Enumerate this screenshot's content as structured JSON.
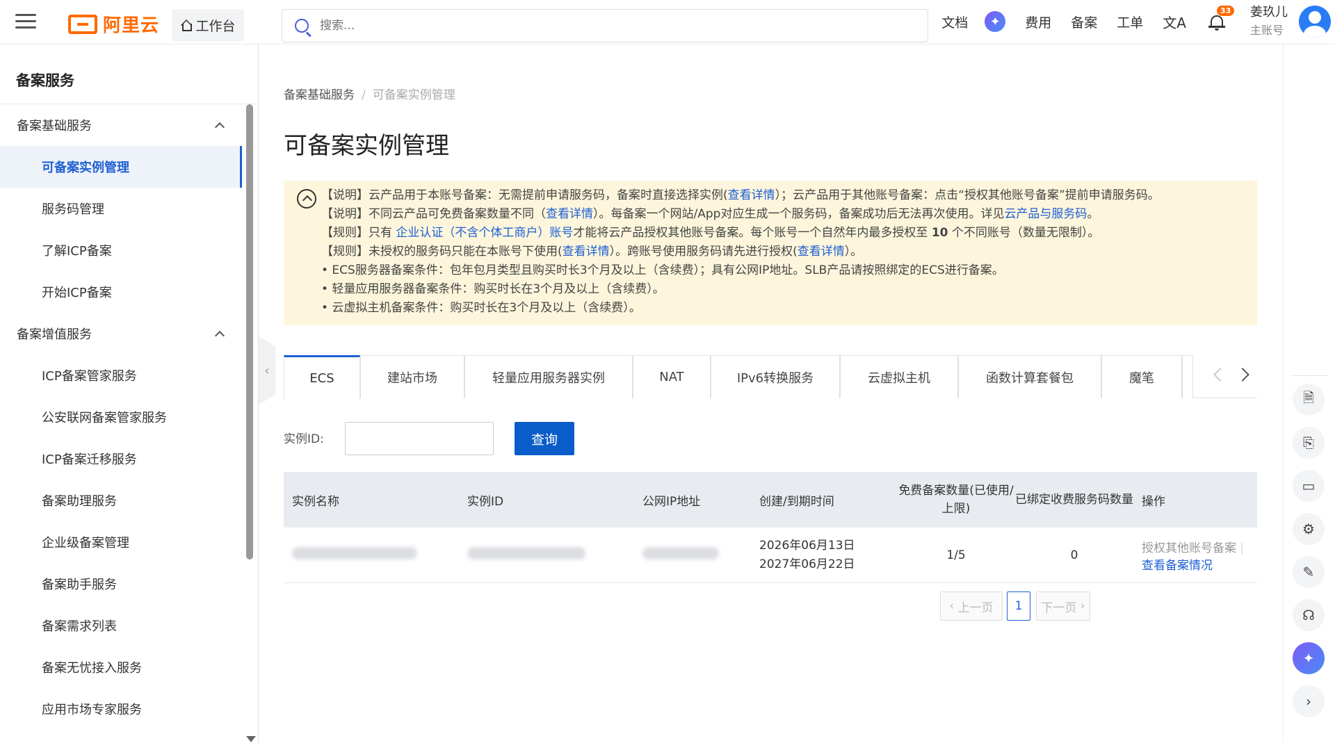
{
  "header": {
    "logo_text": "阿里云",
    "workbench": "工作台",
    "search_placeholder": "搜索...",
    "nav": {
      "docs": "文档",
      "fees": "费用",
      "beian": "备案",
      "tickets": "工单"
    },
    "bell_badge": "33",
    "user": {
      "name": "姜玖儿",
      "role": "主账号"
    }
  },
  "sidebar": {
    "title": "备案服务",
    "group1": "备案基础服务",
    "group1_items": [
      "可备案实例管理",
      "服务码管理",
      "了解ICP备案",
      "开始ICP备案"
    ],
    "group2": "备案增值服务",
    "group2_items": [
      "ICP备案管家服务",
      "公安联网备案管家服务",
      "ICP备案迁移服务",
      "备案助理服务",
      "企业级备案管理",
      "备案助手服务",
      "备案需求列表",
      "备案无忧接入服务",
      "应用市场专家服务"
    ]
  },
  "breadcrumb": {
    "parent": "备案基础服务",
    "sep": "/",
    "current": "可备案实例管理"
  },
  "page_title": "可备案实例管理",
  "notice": {
    "l1a": "【说明】云产品用于本账号备案：无需提前申请服务码，备案时直接选择实例(",
    "l1link": "查看详情",
    "l1b": "）；云产品用于其他账号备案：点击“授权其他账号备案”提前申请服务码。",
    "l2a": "【说明】不同云产品可免费备案数量不同（",
    "l2link": "查看详情",
    "l2b": "）。每备案一个网站/App对应生成一个服务码，备案成功后无法再次使用。详见",
    "l2link2": "云产品与服务码",
    "l2c": "。",
    "l3a": "【规则】只有 ",
    "l3link": "企业认证（不含个体工商户）账号",
    "l3b": "才能将云产品授权其他账号备案。每个账号一个自然年内最多授权至 ",
    "l3num": "10",
    "l3c": " 个不同账号（数量无限制）。",
    "l4a": "【规则】未授权的服务码只能在本账号下使用(",
    "l4link": "查看详情",
    "l4b": "）。跨账号使用服务码请先进行授权(",
    "l4link2": "查看详情",
    "l4c": "）。",
    "l5": "• ECS服务器备案条件：包年包月类型且购买时长3个月及以上（含续费）；具有公网IP地址。SLB产品请按照绑定的ECS进行备案。",
    "l6": "• 轻量应用服务器备案条件：购买时长在3个月及以上（含续费）。",
    "l7": "• 云虚拟主机备案条件：购买时长在3个月及以上（含续费）。"
  },
  "tabs": [
    "ECS",
    "建站市场",
    "轻量应用服务器实例",
    "NAT",
    "IPv6转换服务",
    "云虚拟主机",
    "函数计算套餐包",
    "魔笔"
  ],
  "filter": {
    "label": "实例ID:",
    "value": "",
    "button": "查询"
  },
  "table": {
    "headers": [
      "实例名称",
      "实例ID",
      "公网IP地址",
      "创建/到期时间",
      "免费备案数量(已使用/上限)",
      "已绑定收费服务码数量",
      "操作"
    ],
    "rows": [
      {
        "created": "2026年06月13日",
        "expires": "2027年06月22日",
        "free_count": "1/5",
        "bound": "0",
        "op_authorize": "授权其他账号备案",
        "op_view": "查看备案情况"
      }
    ]
  },
  "pagination": {
    "prev": "上一页",
    "page": "1",
    "next": "下一页"
  },
  "icons": {
    "notice_toggle": "chevron-up-circle-icon",
    "ai": "ai-assistant-icon"
  },
  "colors": {
    "brand": "#ff6a00",
    "primary": "#0a5dc9",
    "link": "#1e5fd3",
    "notice_bg": "#fdf6dc"
  }
}
